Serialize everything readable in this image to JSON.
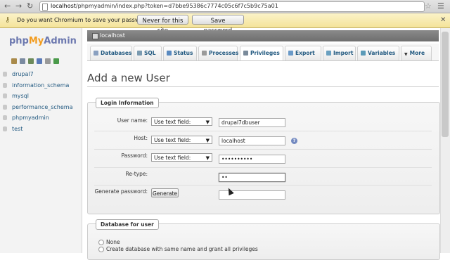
{
  "browser": {
    "url_host": "localhost",
    "url_path": "/phpmyadmin/index.php?token=d7bbe95386c7774c05c6f7c5b9c75a01",
    "back_icon": "back-arrow-icon",
    "forward_icon": "forward-arrow-icon",
    "reload_icon": "reload-icon"
  },
  "infobar": {
    "message": "Do you want Chromium to save your password?",
    "never_label": "Never for this site",
    "save_label": "Save password"
  },
  "sidebar": {
    "logo_php": "php",
    "logo_my": "My",
    "logo_admin": "Admin",
    "databases": [
      "drupal7",
      "information_schema",
      "mysql",
      "performance_schema",
      "phpmyadmin",
      "test"
    ]
  },
  "server": {
    "label": "localhost"
  },
  "tabs": [
    {
      "label": "Databases",
      "active": false
    },
    {
      "label": "SQL",
      "active": false
    },
    {
      "label": "Status",
      "active": false
    },
    {
      "label": "Processes",
      "active": false
    },
    {
      "label": "Privileges",
      "active": true
    },
    {
      "label": "Export",
      "active": false
    },
    {
      "label": "Import",
      "active": false
    },
    {
      "label": "Variables",
      "active": false
    },
    {
      "label": "More",
      "active": false
    }
  ],
  "page": {
    "title": "Add a new User"
  },
  "login": {
    "legend": "Login Information",
    "user_name_label": "User name:",
    "user_name_mode": "Use text field:",
    "user_name_value": "drupal7dbuser",
    "host_label": "Host:",
    "host_mode": "Use text field:",
    "host_value": "localhost",
    "password_label": "Password:",
    "password_mode": "Use text field:",
    "password_value": "••••••••••",
    "retype_label": "Re-type:",
    "retype_value": "••",
    "generate_label": "Generate password:",
    "generate_button": "Generate",
    "generated_value": ""
  },
  "database_for_user": {
    "legend": "Database for user",
    "options": [
      "None",
      "Create database with same name and grant all privileges"
    ]
  },
  "colors": {
    "link": "#235a81",
    "logo_php": "#6c78af",
    "logo_my": "#f29b1d",
    "infobar": "#f4e39a"
  }
}
